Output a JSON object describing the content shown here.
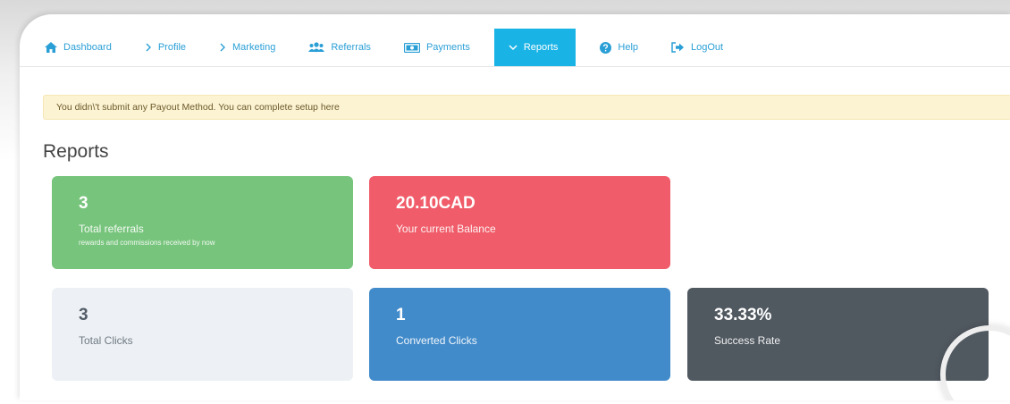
{
  "nav": {
    "items": [
      {
        "label": "Dashboard",
        "icon": "home-icon"
      },
      {
        "label": "Profile",
        "icon": "chevron-right-icon"
      },
      {
        "label": "Marketing",
        "icon": "chevron-right-icon"
      },
      {
        "label": "Referrals",
        "icon": "users-icon"
      },
      {
        "label": "Payments",
        "icon": "money-icon"
      },
      {
        "label": "Reports",
        "icon": "chevron-down-icon",
        "active": true
      },
      {
        "label": "Help",
        "icon": "question-circle-icon"
      },
      {
        "label": "LogOut",
        "icon": "sign-out-icon"
      }
    ],
    "accent": "#1ab3e6",
    "link_color": "#2a9fd6"
  },
  "alert": {
    "text": "You didn\\'t submit any Payout Method. You can complete setup here"
  },
  "page": {
    "title": "Reports"
  },
  "cards": {
    "total_referrals": {
      "value": "3",
      "label": "Total referrals",
      "sublabel": "rewards and commissions received by now",
      "color": "#77c47c"
    },
    "balance": {
      "value": "20.10CAD",
      "label": "Your current Balance",
      "color": "#f05c69"
    },
    "total_clicks": {
      "value": "3",
      "label": "Total Clicks",
      "color": "#edf1f5"
    },
    "converted_clicks": {
      "value": "1",
      "label": "Converted Clicks",
      "color": "#428bca"
    },
    "success_rate": {
      "value": "33.33%",
      "label": "Success Rate",
      "color": "#505860"
    }
  }
}
